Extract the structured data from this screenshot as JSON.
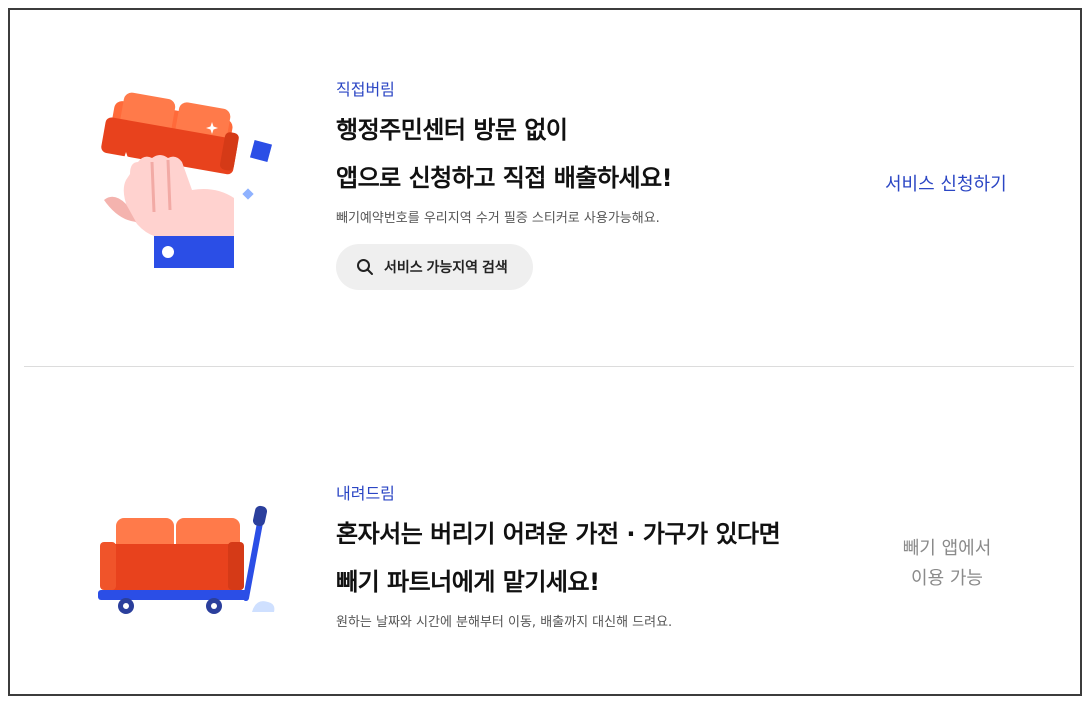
{
  "sections": [
    {
      "eyebrow": "직접버림",
      "headline_line1": "행정주민센터 방문 없이",
      "headline_line2": "앱으로 신청하고 직접 배출하세요!",
      "description": "빼기예약번호를 우리지역 수거 필증 스티커로 사용가능해요.",
      "search_button_label": "서비스 가능지역 검색",
      "action_label": "서비스 신청하기",
      "illustration_icon": "hand-holding-sofa-icon"
    },
    {
      "eyebrow": "내려드림",
      "headline_line1": "혼자서는 버리기 어려운 가전 · 가구가 있다면",
      "headline_line2": "빼기 파트너에게 맡기세요!",
      "description": "원하는 날짜와 시간에 분해부터 이동, 배출까지 대신해 드려요.",
      "status_line1": "빼기 앱에서",
      "status_line2": "이용 가능",
      "illustration_icon": "sofa-on-cart-icon"
    }
  ],
  "colors": {
    "accent_blue": "#2b46c4",
    "sofa_orange": "#f0542a",
    "muted_gray": "#8a8a8a",
    "button_bg": "#efefef"
  }
}
